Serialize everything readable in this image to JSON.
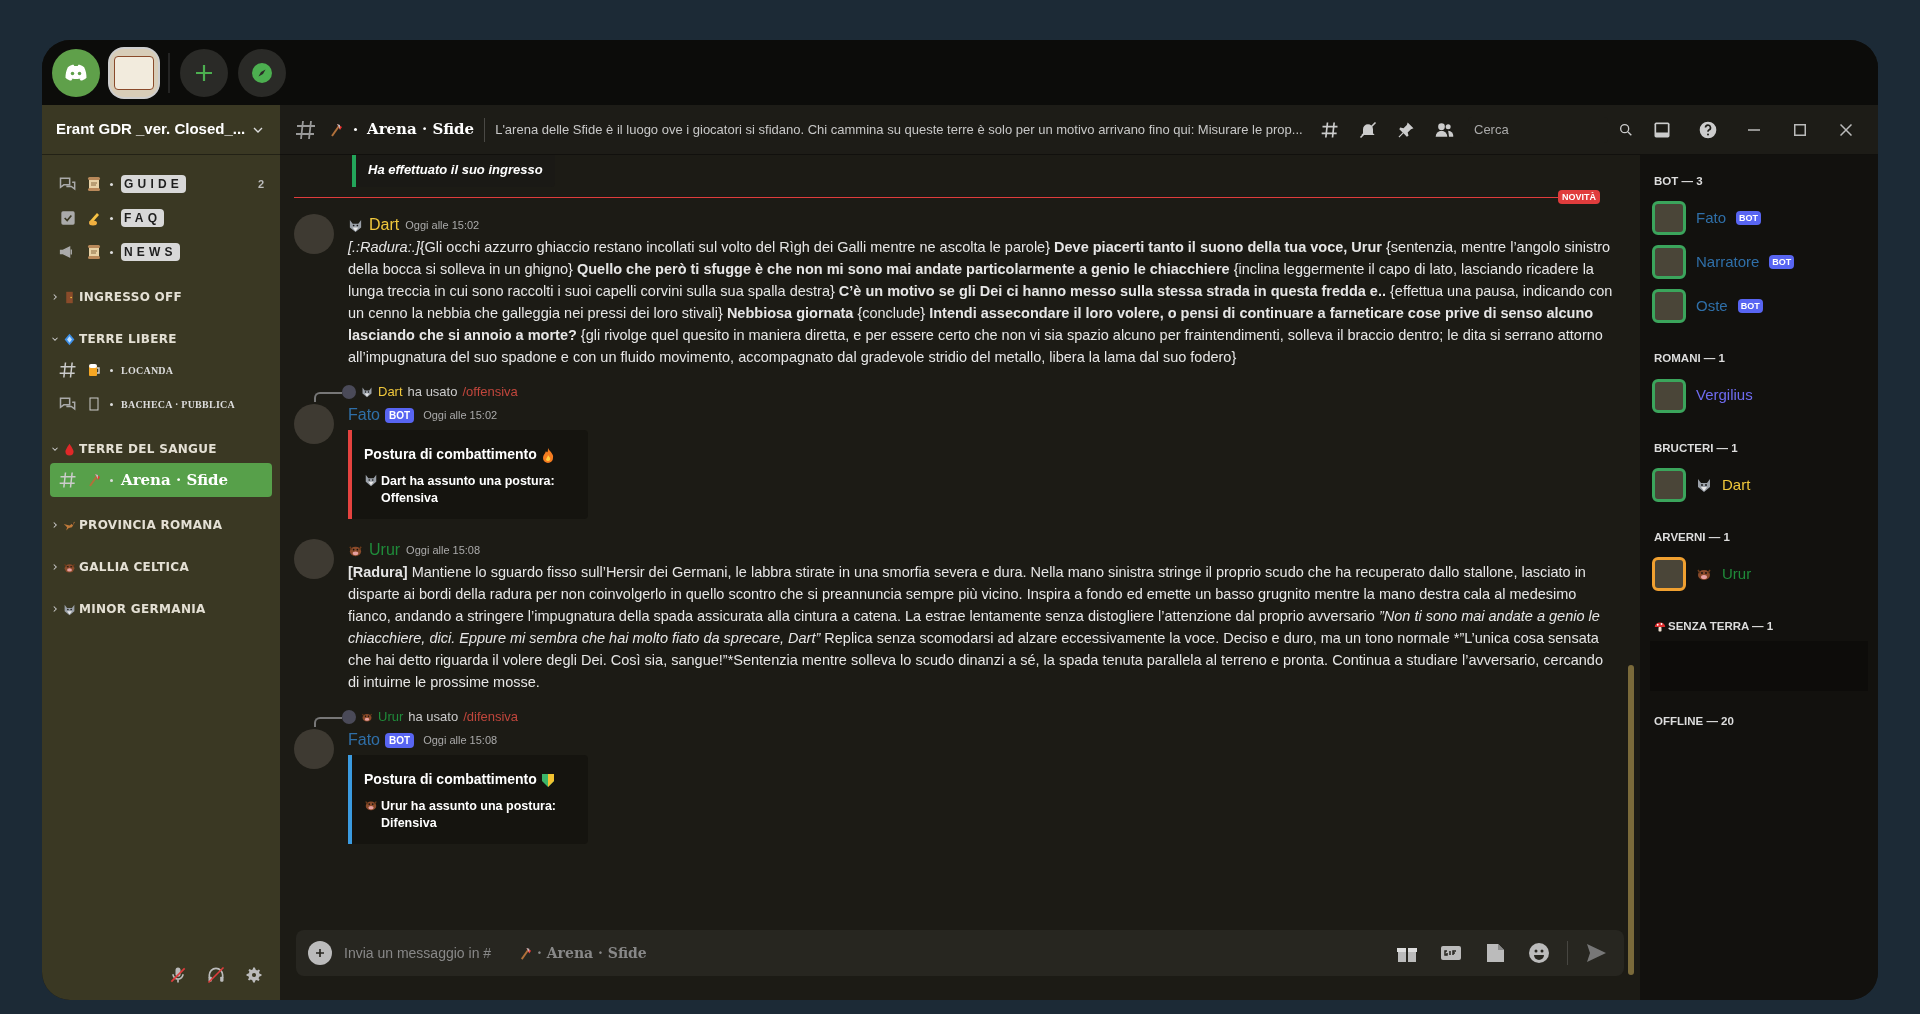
{
  "server_bar": {
    "items": [
      {
        "kind": "home",
        "selected": false
      },
      {
        "kind": "server",
        "selected": true
      },
      {
        "kind": "add",
        "selected": false
      },
      {
        "kind": "explore",
        "selected": false
      }
    ]
  },
  "sidebar": {
    "server_name": "Erant GDR _ver. Closed_...",
    "channels": [
      {
        "kind": "channel",
        "name": "GUIDE",
        "badge": "2",
        "selected": false
      },
      {
        "kind": "channel",
        "name": "FAQ",
        "selected": false
      },
      {
        "kind": "channel",
        "name": "NEWS",
        "selected": false
      },
      {
        "kind": "category",
        "name": "INGRESSO OFF",
        "expanded": false
      },
      {
        "kind": "category",
        "name": "TERRE LIBERE",
        "expanded": true
      },
      {
        "kind": "channel",
        "name": "LOCANDA",
        "selected": false
      },
      {
        "kind": "channel",
        "name": "BACHECA · PUBBLICA",
        "selected": false
      },
      {
        "kind": "category",
        "name": "TERRE DEL SANGUE",
        "expanded": true
      },
      {
        "kind": "channel",
        "name": "Arena · Sfide",
        "selected": true
      },
      {
        "kind": "category",
        "name": "PROVINCIA ROMANA",
        "expanded": false
      },
      {
        "kind": "category",
        "name": "GALLIA CELTICA",
        "expanded": false
      },
      {
        "kind": "category",
        "name": "MINOR GERMANIA",
        "expanded": false
      }
    ],
    "voice": {
      "mic_muted": true,
      "deafened": true
    }
  },
  "header": {
    "channel": "Arena · Sfide",
    "topic": "L'arena delle Sfide è il luogo ove i giocatori si sfidano. Chi cammina su queste terre è solo per un motivo arrivano fino qui: Misurare le prop...",
    "search_placeholder": "Cerca"
  },
  "messages": [
    {
      "kind": "embed_tail",
      "color": "#23a55a",
      "text": "Ha effettuato il suo ingresso"
    },
    {
      "kind": "divider",
      "label": "NOVITÀ"
    },
    {
      "kind": "message",
      "author": "Dart",
      "color": "#f0c83c",
      "time": "Oggi alle 15:02",
      "text": "*[.:Radura:.]*{Gli occhi azzurro ghiaccio restano incollati sul volto del Rìgh dei Galli mentre ne ascolta le parole} **Deve piacerti tanto il suono della tua voce, Urur** {sentenzia, mentre l’angolo sinistro della bocca si solleva in un ghigno} **Quello che però ti sfugge è che non mi sono mai andate particolarmente a genio le chiacchiere** {inclina leggermente il capo di lato, lasciando ricadere la lunga treccia in cui sono raccolti i suoi capelli corvini sulla sua spalla destra} **C’è un motivo se gli Dei ci hanno messo sulla stessa strada in questa fredda e..** {effettua una pausa, indicando con un cenno la nebbia che galleggia nei pressi dei loro stivali} **Nebbiosa giornata** {conclude} **Intendi assecondare il loro volere, o pensi di continuare a farneticare cose prive di senso alcuno lasciando che si annoio a morte?** {gli rivolge quel quesito in maniera diretta, e per essere certo che non vi sia spazio alcuno per fraintendimenti, solleva il braccio dentro; le dita si serrano attorno all’impugnatura del suo spadone e con un fluido movimento, accompagnato dal gradevole stridio del metallo, libera la lama dal suo fodero}"
    },
    {
      "kind": "bot",
      "reply": {
        "user": "Dart",
        "color": "#f0c83c",
        "verb": "ha usato",
        "command": "/offensiva"
      },
      "author": "Fato",
      "badge": "BOT",
      "time": "Oggi alle 15:02",
      "embed": {
        "color": "#e5433f",
        "title": "Postura di combattimento",
        "text": "Dart ha assunto una postura: Offensiva"
      }
    },
    {
      "kind": "message",
      "author": "Urur",
      "color": "#1f8b3a",
      "time": "Oggi alle 15:08",
      "text": "**[Radura]** Mantiene lo sguardo fisso sull’Hersir dei Germani, le labbra stirate in una smorfia severa e dura. Nella mano sinistra stringe il proprio scudo che ha recuperato dallo stallone, lasciato in disparte ai bordi della radura per non coinvolgerlo in quello scontro che si preannuncia sempre più vicino. Inspira a fondo ed emette un basso grugnito mentre la mano destra cala al medesimo fianco, andando a stringere l’impugnatura della spada assicurata alla cintura a catena. La estrae lentamente senza distogliere l’attenzione dal proprio avversario *”Non ti sono mai andate a genio le chiacchiere, dici. Eppure mi sembra che hai molto fiato da sprecare, Dart”* Replica senza scomodarsi ad alzare eccessivamente la voce. Deciso e duro, ma un tono normale *”L’unica cosa sensata che hai detto riguarda il volere degli Dei. Così sia, sangue!”*Sentenzia mentre solleva lo scudo dinanzi a sé, la spada tenuta parallela al terreno e pronta. Continua a studiare l’avversario, cercando di intuirne le prossime mosse."
    },
    {
      "kind": "bot",
      "reply": {
        "user": "Urur",
        "color": "#1f8b3a",
        "verb": "ha usato",
        "command": "/difensiva"
      },
      "author": "Fato",
      "badge": "BOT",
      "time": "Oggi alle 15:08",
      "embed": {
        "color": "#3b9be0",
        "title": "Postura di combattimento",
        "text": "Urur ha assunto una postura: Difensiva"
      }
    }
  ],
  "composer": {
    "placeholder": "Invia un messaggio in #",
    "channel_hint": "· Arena · Sfide"
  },
  "members": [
    {
      "kind": "group",
      "title": "BOT — 3",
      "members": [
        {
          "name": "Fato",
          "color": "#2f6fa8",
          "avatar": {
            "color": "#3ba55c"
          },
          "badge": "BOT"
        },
        {
          "name": "Narratore",
          "color": "#2f6fa8",
          "avatar": {
            "color": "#3ba55c"
          },
          "badge": "BOT"
        },
        {
          "name": "Oste",
          "color": "#2f6fa8",
          "avatar": {
            "color": "#3ba55c"
          },
          "badge": "BOT"
        }
      ]
    },
    {
      "kind": "group",
      "title": "ROMANI — 1",
      "members": [
        {
          "name": "Vergilius",
          "color": "#6f6cf0",
          "avatar": {
            "color": "#3ba55c"
          }
        }
      ]
    },
    {
      "kind": "group",
      "title": "BRUCTERI — 1",
      "members": [
        {
          "name": "Dart",
          "color": "#f0c83c",
          "avatar": {
            "color": "#3ba55c"
          }
        }
      ]
    },
    {
      "kind": "group",
      "title": "ARVERNI — 1",
      "members": [
        {
          "name": "Urur",
          "color": "#1f8b3a",
          "avatar": {
            "color": "#f0a030"
          }
        }
      ]
    },
    {
      "kind": "hidden",
      "title": "SENZA TERRA — 1"
    },
    {
      "kind": "hidden_empty",
      "title": "OFFLINE — 20"
    }
  ]
}
